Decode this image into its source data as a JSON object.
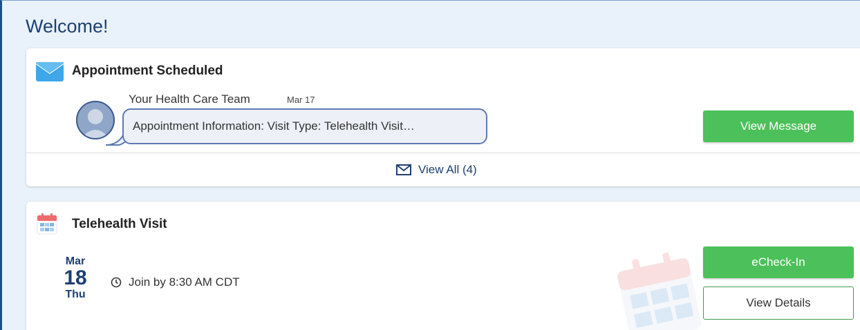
{
  "page": {
    "welcome": "Welcome!"
  },
  "message_card": {
    "title": "Appointment Scheduled",
    "sender": "Your Health Care Team",
    "date": "Mar 17",
    "preview": "Appointment Information: Visit Type: Telehealth Visit…",
    "view_message_label": "View Message",
    "view_all_label": "View All (4)",
    "icon": "envelope-icon"
  },
  "visit_card": {
    "title": "Telehealth Visit",
    "month": "Mar",
    "day": "18",
    "weekday": "Thu",
    "join_text": "Join by 8:30 AM CDT",
    "echeckin_label": "eCheck-In",
    "view_details_label": "View Details",
    "icon": "calendar-icon"
  },
  "colors": {
    "accent_blue": "#1d3f70",
    "button_green": "#4cc05a",
    "background": "#e9f2fa"
  }
}
